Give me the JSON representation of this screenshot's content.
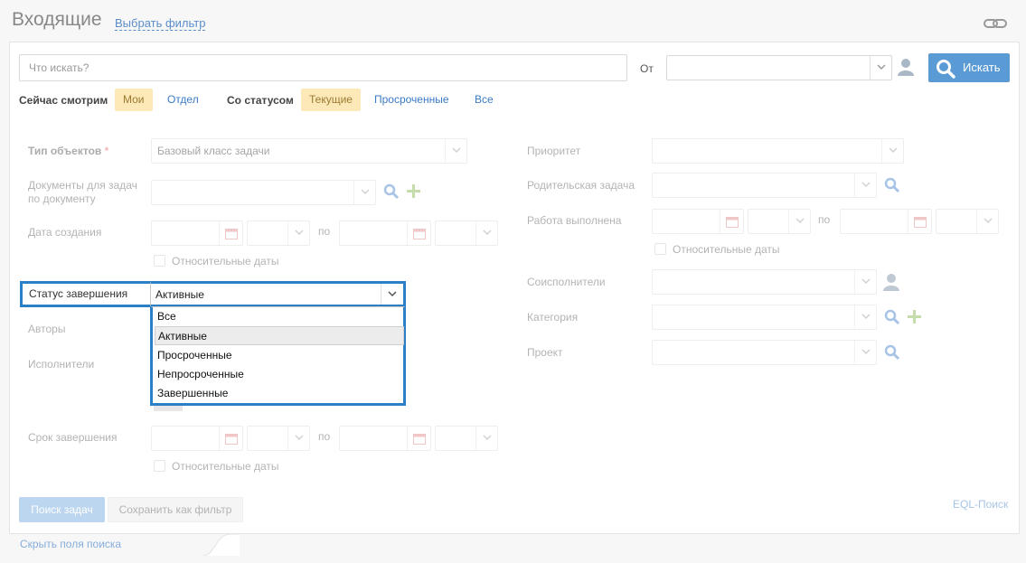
{
  "header": {
    "title": "Входящие",
    "filter_link": "Выбрать фильтр"
  },
  "search": {
    "placeholder": "Что искать?",
    "from_label": "От",
    "button_label": "Искать"
  },
  "quick_filters": {
    "viewing_label": "Сейчас смотрим",
    "viewing_options": [
      {
        "label": "Мои",
        "active": true
      },
      {
        "label": "Отдел",
        "active": false
      }
    ],
    "status_label": "Со статусом",
    "status_options": [
      {
        "label": "Текущие",
        "active": true
      },
      {
        "label": "Просроченные",
        "active": false
      },
      {
        "label": "Все",
        "active": false
      }
    ]
  },
  "form": {
    "object_type_label": "Тип объектов",
    "required_mark": "*",
    "object_type_value": "Базовый класс задачи",
    "docs_label_line1": "Документы для задач",
    "docs_label_line2": "по документу",
    "created_label": "Дата создания",
    "to_label": "по",
    "relative_dates": "Относительные даты",
    "status_label": "Статус завершения",
    "status_value": "Активные",
    "status_options": [
      "Все",
      "Активные",
      "Просроченные",
      "Непросроченные",
      "Завершенные"
    ],
    "status_highlighted_index": 1,
    "authors_label": "Авторы",
    "executors_label": "Исполнители",
    "deadline_label": "Срок завершения",
    "priority_label": "Приоритет",
    "parent_task_label": "Родительская задача",
    "work_done_label": "Работа выполнена",
    "co_executors_label": "Соисполнители",
    "category_label": "Категория",
    "project_label": "Проект"
  },
  "footer": {
    "search_tasks_button": "Поиск задач",
    "save_filter_button": "Сохранить как фильтр",
    "eql_link": "EQL-Поиск",
    "hide_fields_link": "Скрыть поля поиска"
  },
  "colors": {
    "accent": "#5b9bd5",
    "highlight_border": "#2b7fc6",
    "chip_active_bg": "#fde9b8",
    "link": "#3a7bc8"
  }
}
